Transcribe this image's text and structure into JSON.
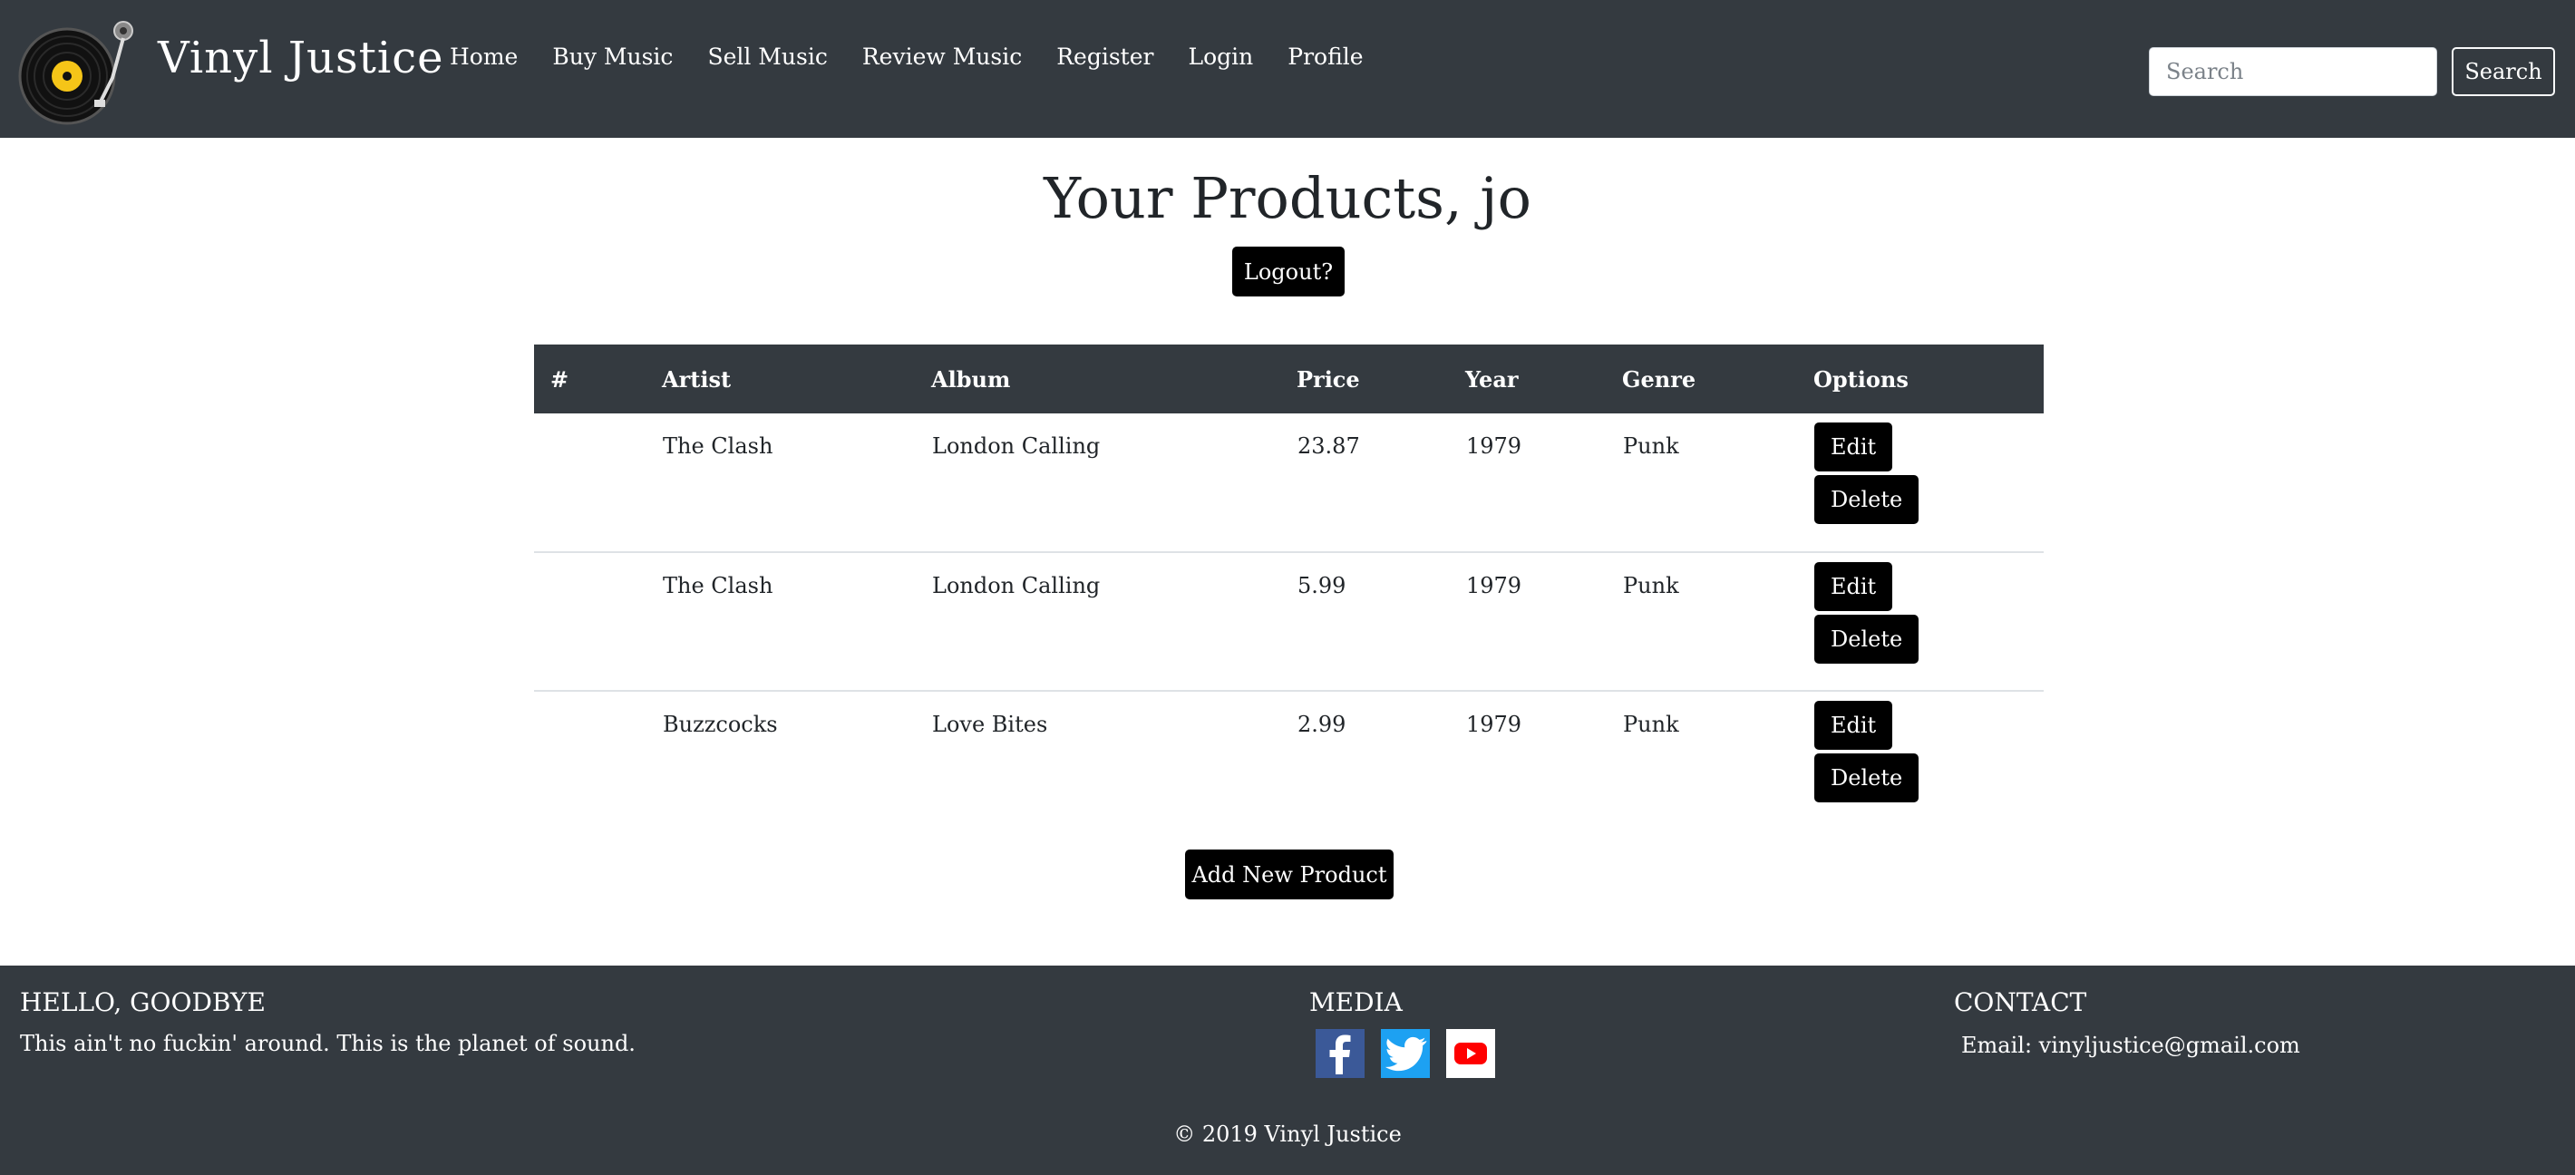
{
  "nav": {
    "brand": "Vinyl Justice",
    "links": [
      "Home",
      "Buy Music",
      "Sell Music",
      "Review Music",
      "Register",
      "Login",
      "Profile"
    ],
    "search_placeholder": "Search",
    "search_button": "Search"
  },
  "main": {
    "title": "Your Products, jo",
    "logout_label": "Logout?",
    "table": {
      "headers": [
        "#",
        "Artist",
        "Album",
        "Price",
        "Year",
        "Genre",
        "Options"
      ],
      "rows": [
        {
          "num": "",
          "artist": "The Clash",
          "album": "London Calling",
          "price": "23.87",
          "year": "1979",
          "genre": "Punk"
        },
        {
          "num": "",
          "artist": "The Clash",
          "album": "London Calling",
          "price": "5.99",
          "year": "1979",
          "genre": "Punk"
        },
        {
          "num": "",
          "artist": "Buzzcocks",
          "album": "Love Bites",
          "price": "2.99",
          "year": "1979",
          "genre": "Punk"
        }
      ],
      "edit_label": "Edit",
      "delete_label": "Delete"
    },
    "add_label": "Add New Product"
  },
  "footer": {
    "hello_heading": "HELLO, GOODBYE",
    "hello_text": "This ain't no fuckin' around. This is the planet of sound.",
    "media_heading": "MEDIA",
    "social_icons": [
      "facebook-icon",
      "twitter-icon",
      "youtube-icon"
    ],
    "contact_heading": "CONTACT",
    "contact_text": "Email: vinyljustice@gmail.com",
    "copyright": "© 2019 Vinyl Justice"
  },
  "colors": {
    "navbar_bg": "#343a40",
    "button_bg": "#000000",
    "record_label": "#f5c518",
    "facebook": "#3b5998",
    "twitter": "#1da1f2",
    "youtube": "#ff0000"
  }
}
